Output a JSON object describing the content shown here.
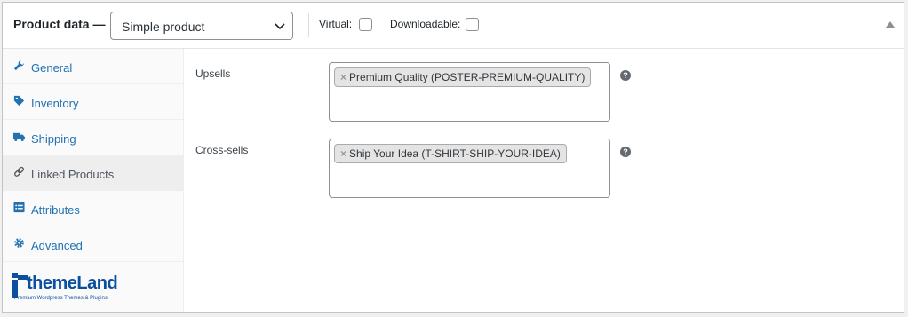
{
  "header": {
    "title": "Product data —",
    "product_type": "Simple product",
    "virtual_label": "Virtual:",
    "downloadable_label": "Downloadable:"
  },
  "tabs": [
    {
      "label": "General",
      "icon": "wrench-icon"
    },
    {
      "label": "Inventory",
      "icon": "tag-icon"
    },
    {
      "label": "Shipping",
      "icon": "truck-icon"
    },
    {
      "label": "Linked Products",
      "icon": "link-icon",
      "active": true
    },
    {
      "label": "Attributes",
      "icon": "list-icon"
    },
    {
      "label": "Advanced",
      "icon": "gear-icon"
    }
  ],
  "fields": {
    "upsells": {
      "label": "Upsells",
      "tokens": [
        "Premium Quality (POSTER-PREMIUM-QUALITY)"
      ]
    },
    "crosssells": {
      "label": "Cross-sells",
      "tokens": [
        "Ship Your Idea (T-SHIRT-SHIP-YOUR-IDEA)"
      ]
    }
  },
  "token_remove": "×",
  "help_glyph": "?",
  "watermark": {
    "name": "themeLand",
    "tagline": "Premium Wordpress Themes & Plugins"
  },
  "colors": {
    "link": "#2271b1",
    "active_tab_bg": "#eeeeee",
    "logo": "#0b4fa0"
  }
}
